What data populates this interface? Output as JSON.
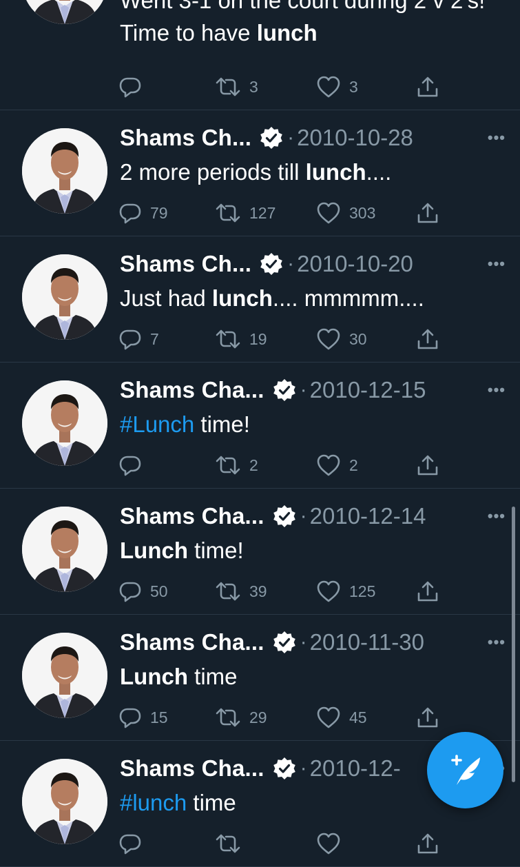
{
  "colors": {
    "background": "#15202b",
    "text": "#ffffff",
    "secondary_text": "#8899a6",
    "accent": "#1d9bf0",
    "divider": "#2a3846"
  },
  "tweets": [
    {
      "name": "",
      "date": "",
      "segments": [
        {
          "text": "Went 3-1 on the court during 2 v 2's! Time to have ",
          "style": "normal"
        },
        {
          "text": "lunch",
          "style": "bold"
        }
      ],
      "replies": "",
      "retweets": "3",
      "likes": "3"
    },
    {
      "name": "Shams Ch...",
      "date": "2010-10-28",
      "segments": [
        {
          "text": "2 more periods till ",
          "style": "normal"
        },
        {
          "text": "lunch",
          "style": "bold"
        },
        {
          "text": "....",
          "style": "normal"
        }
      ],
      "replies": "79",
      "retweets": "127",
      "likes": "303"
    },
    {
      "name": "Shams Ch...",
      "date": "2010-10-20",
      "segments": [
        {
          "text": "Just had ",
          "style": "normal"
        },
        {
          "text": "lunch",
          "style": "bold"
        },
        {
          "text": ".... mmmmm....",
          "style": "normal"
        }
      ],
      "replies": "7",
      "retweets": "19",
      "likes": "30"
    },
    {
      "name": "Shams Cha...",
      "date": "2010-12-15",
      "segments": [
        {
          "text": "#Lunch",
          "style": "hashtag"
        },
        {
          "text": " time!",
          "style": "normal"
        }
      ],
      "replies": "",
      "retweets": "2",
      "likes": "2"
    },
    {
      "name": "Shams Cha...",
      "date": "2010-12-14",
      "segments": [
        {
          "text": "Lunch",
          "style": "bold"
        },
        {
          "text": " time!",
          "style": "normal"
        }
      ],
      "replies": "50",
      "retweets": "39",
      "likes": "125"
    },
    {
      "name": "Shams Cha...",
      "date": "2010-11-30",
      "segments": [
        {
          "text": "Lunch",
          "style": "bold"
        },
        {
          "text": " time",
          "style": "normal"
        }
      ],
      "replies": "15",
      "retweets": "29",
      "likes": "45"
    },
    {
      "name": "Shams Cha...",
      "date": "2010-12-",
      "segments": [
        {
          "text": "#lunch",
          "style": "hashtag"
        },
        {
          "text": " time",
          "style": "normal"
        }
      ],
      "replies": "",
      "retweets": "",
      "likes": ""
    }
  ],
  "icons": {
    "reply": "reply-icon",
    "retweet": "retweet-icon",
    "like": "heart-icon",
    "share": "share-icon",
    "verified": "verified-badge-icon",
    "more": "more-options-icon",
    "compose": "compose-tweet-icon"
  }
}
